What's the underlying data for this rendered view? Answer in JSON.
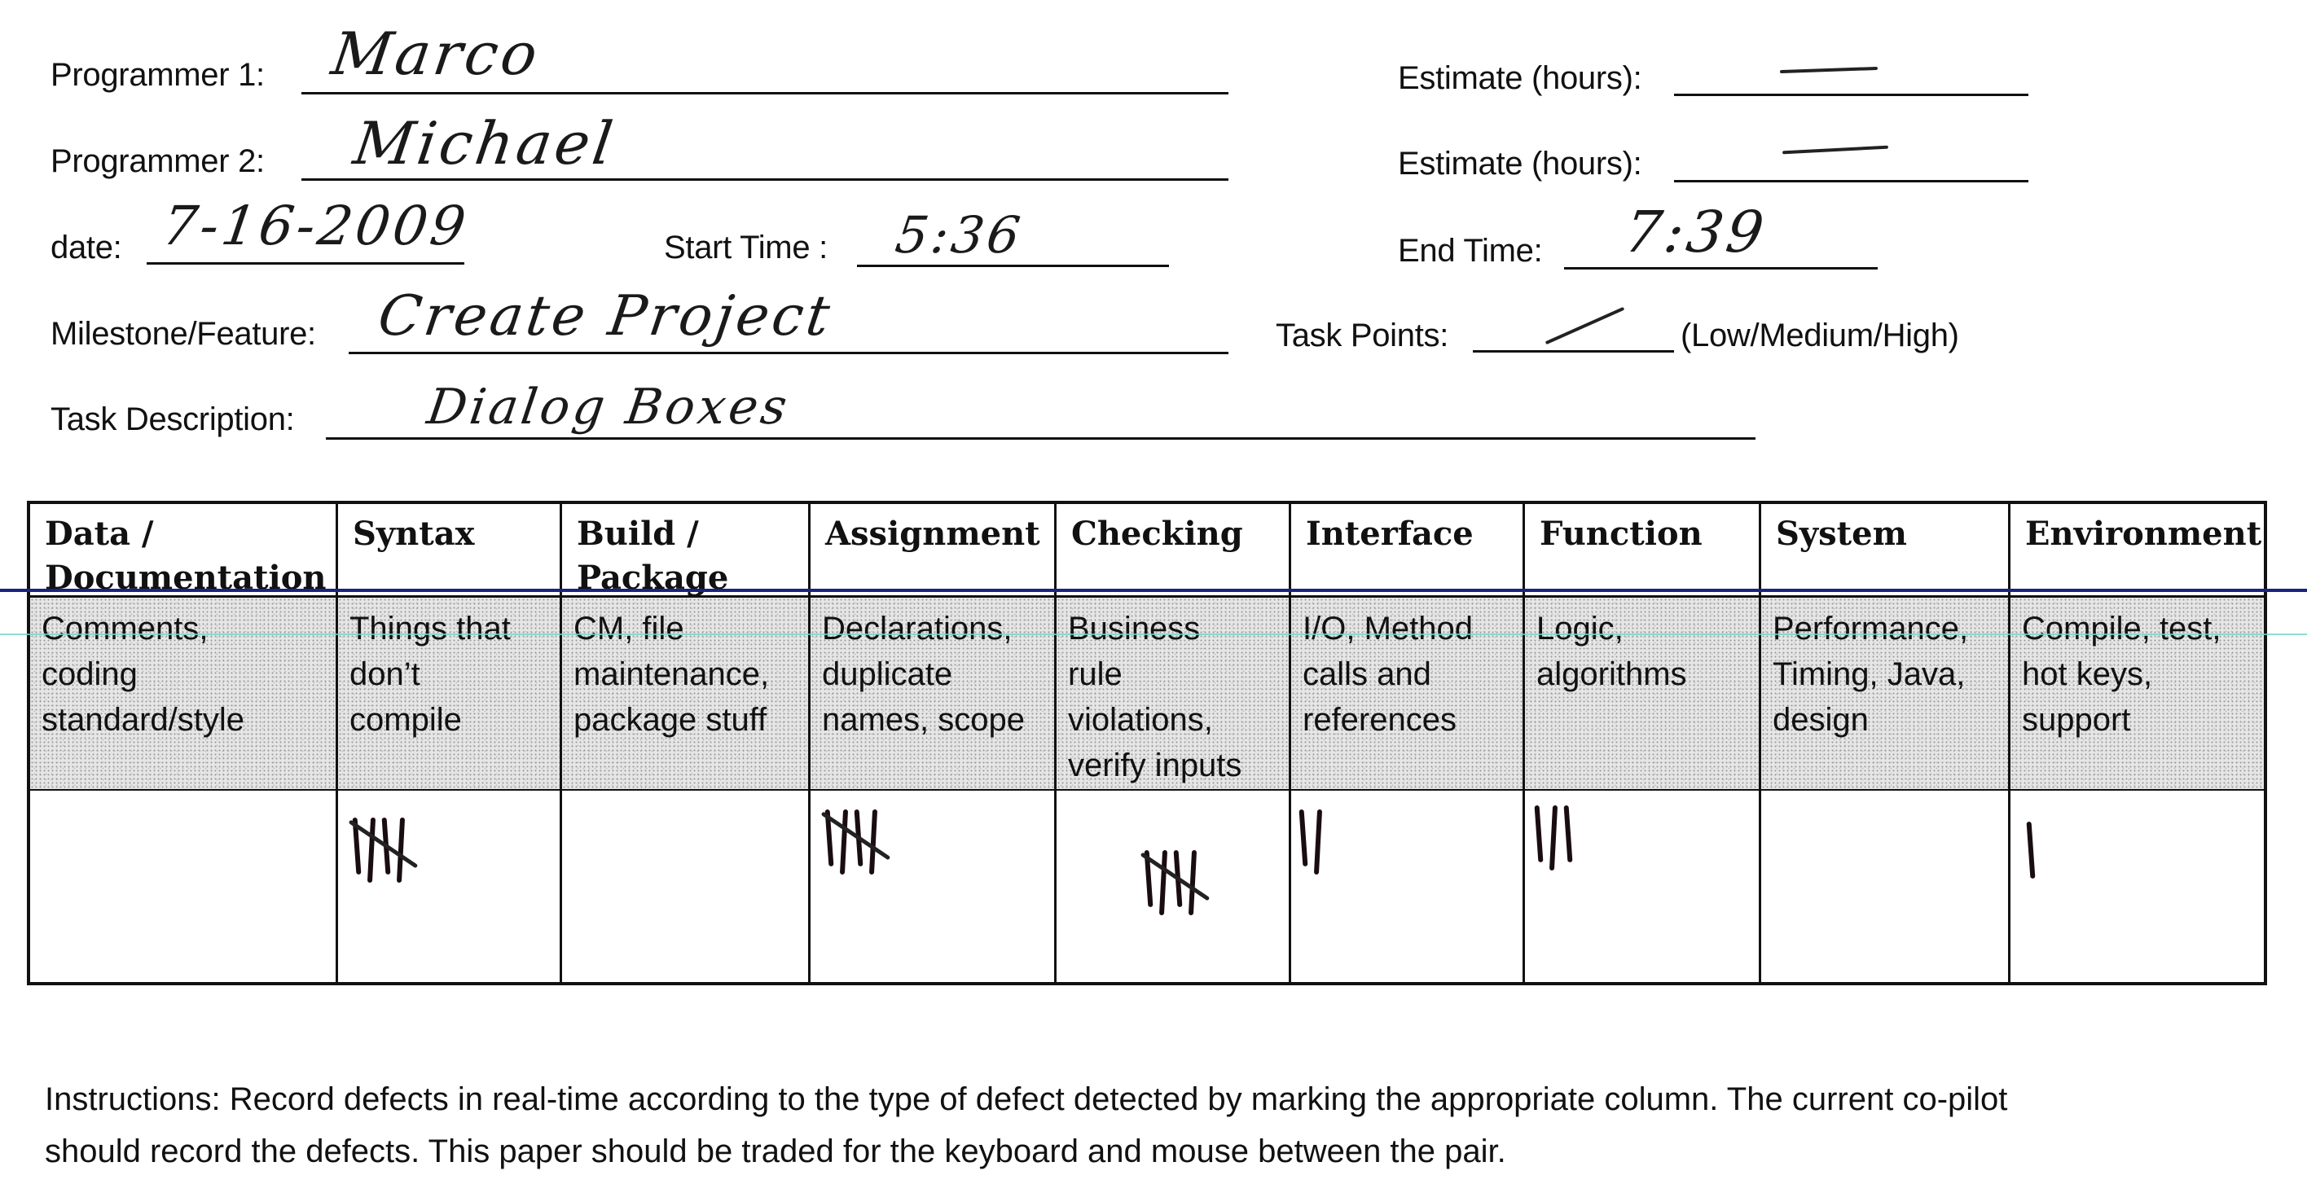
{
  "form": {
    "programmer1": {
      "label": "Programmer 1:",
      "value": "Marco"
    },
    "programmer2": {
      "label": "Programmer 2:",
      "value": "Michael"
    },
    "estimate1": {
      "label": "Estimate (hours):",
      "value": "—"
    },
    "estimate2": {
      "label": "Estimate (hours):",
      "value": "—"
    },
    "date": {
      "label": "date:",
      "value": "7-16-2009"
    },
    "start_time": {
      "label": "Start Time :",
      "value": "5:36"
    },
    "end_time": {
      "label": "End Time:",
      "value": "7:39"
    },
    "milestone": {
      "label": "Milestone/Feature:",
      "value": "Create Project"
    },
    "task_points": {
      "label": "Task Points:",
      "value": "✓",
      "options_hint": "(Low/Medium/High)"
    },
    "task_description": {
      "label": "Task Description:",
      "value": "Dialog Boxes"
    }
  },
  "defect_table": {
    "columns": [
      {
        "header": "Data / Documentation",
        "header_lines": [
          "Data /",
          "Documentation"
        ],
        "description": "Comments, coding standard/style",
        "description_lines": [
          "Comments,",
          "coding",
          "standard/style"
        ],
        "tally": 0
      },
      {
        "header": "Syntax",
        "header_lines": [
          "Syntax"
        ],
        "description": "Things that don’t compile",
        "description_lines": [
          "Things that",
          "don’t",
          "compile"
        ],
        "tally": 5
      },
      {
        "header": "Build / Package",
        "header_lines": [
          "Build /",
          "Package"
        ],
        "description": "CM, file maintenance, package stuff",
        "description_lines": [
          "CM, file",
          "maintenance,",
          "package stuff"
        ],
        "tally": 0
      },
      {
        "header": "Assignment",
        "header_lines": [
          "Assignment"
        ],
        "description": "Declarations, duplicate names, scope",
        "description_lines": [
          "Declarations,",
          "duplicate",
          "names, scope"
        ],
        "tally": 5
      },
      {
        "header": "Checking",
        "header_lines": [
          "Checking"
        ],
        "description": "Business rule violations, verify inputs",
        "description_lines": [
          "Business",
          "rule",
          "violations,",
          "verify inputs"
        ],
        "tally": 5
      },
      {
        "header": "Interface",
        "header_lines": [
          "Interface"
        ],
        "description": "I/O, Method calls and references",
        "description_lines": [
          "I/O, Method",
          "calls and",
          "references"
        ],
        "tally": 2
      },
      {
        "header": "Function",
        "header_lines": [
          "Function"
        ],
        "description": "Logic, algorithms",
        "description_lines": [
          "Logic,",
          "algorithms"
        ],
        "tally": 3
      },
      {
        "header": "System",
        "header_lines": [
          "System"
        ],
        "description": "Performance, Timing, Java, design",
        "description_lines": [
          "Performance,",
          "Timing, Java,",
          "design"
        ],
        "tally": 0
      },
      {
        "header": "Environment",
        "header_lines": [
          "Environment"
        ],
        "description": "Compile, test, hot keys, support",
        "description_lines": [
          "Compile, test,",
          "hot keys,",
          "support"
        ],
        "tally": 1
      }
    ]
  },
  "instructions": {
    "line1": "Instructions: Record defects in real-time according to the type of defect detected by marking the appropriate column.  The current co-pilot",
    "line2": "should record the defects.  This paper should be traded for the keyboard and mouse between the pair."
  }
}
